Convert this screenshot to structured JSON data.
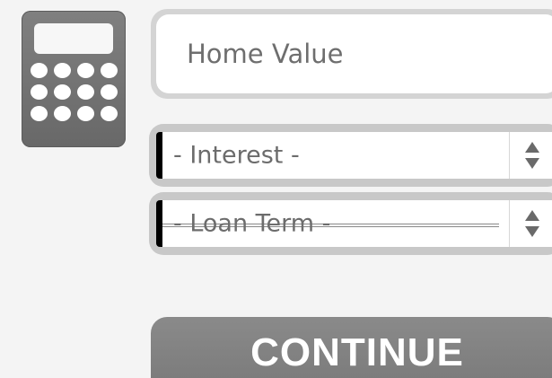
{
  "calculator": {
    "icon": "calculator-icon",
    "key_count": 12
  },
  "form": {
    "home_value": {
      "placeholder": "Home Value",
      "value": ""
    },
    "interest": {
      "selected": "- Interest -",
      "arrows_icon": "updown-arrows-icon"
    },
    "loan_term": {
      "selected": "- Loan Term -",
      "arrows_icon": "updown-arrows-icon"
    },
    "continue_label": "CONTINUE"
  },
  "colors": {
    "background": "#f4f4f4",
    "icon_gray": "#767676",
    "button_gray": "#828282",
    "field_border": "#d4d4d4",
    "text_gray": "#6e6e6e"
  }
}
